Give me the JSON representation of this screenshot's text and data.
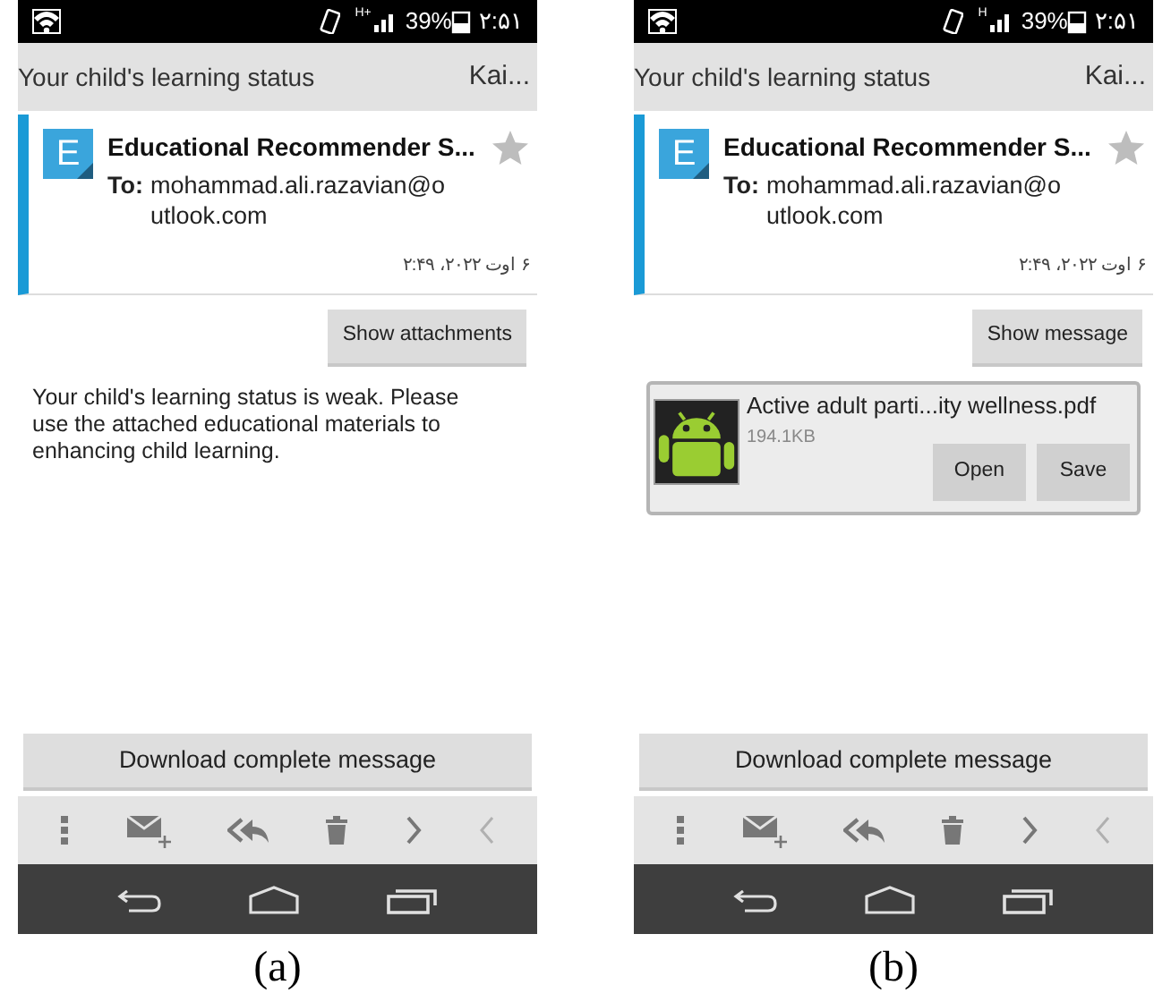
{
  "panels": [
    {
      "caption": "(a)",
      "status_bar": {
        "network": "H+",
        "battery": "39%",
        "time": "۲:۵۱"
      },
      "subject": "Your child's learning status",
      "sender_short": "Kai...",
      "message": {
        "avatar_letter": "E",
        "sender": "Educational Recommender S...",
        "to_label": "To:",
        "to": "mohammad.ali.razavian@outlook.com",
        "starred": false,
        "date": "۶ اوت ۲۰۲۲، ۲:۴۹"
      },
      "toggle_button": "Show attachments",
      "content": {
        "kind": "body",
        "text": "Your child's learning status is weak. Please use the attached educational materials to enhancing child learning."
      },
      "download_button": "Download complete message"
    },
    {
      "caption": "(b)",
      "status_bar": {
        "network": "H",
        "battery": "39%",
        "time": "۲:۵۱"
      },
      "subject": "Your child's learning status",
      "sender_short": "Kai...",
      "message": {
        "avatar_letter": "E",
        "sender": "Educational Recommender S...",
        "to_label": "To:",
        "to": "mohammad.ali.razavian@outlook.com",
        "starred": false,
        "date": "۶ اوت ۲۰۲۲، ۲:۴۹"
      },
      "toggle_button": "Show message",
      "content": {
        "kind": "attachment",
        "filename": "Active adult parti...ity wellness.pdf",
        "size": "194.1KB",
        "buttons": [
          "Open",
          "Save"
        ]
      },
      "download_button": "Download complete message"
    }
  ]
}
